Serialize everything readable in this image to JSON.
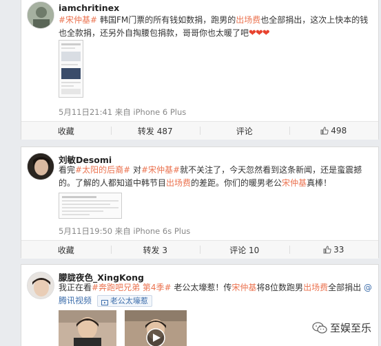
{
  "posts": [
    {
      "author": "iamchritinex",
      "text_parts": [
        {
          "t": "#宋仲基#",
          "c": "tag"
        },
        {
          "t": " 韩国FM门票的所有钱如数捐，跑男的",
          "c": ""
        },
        {
          "t": "出场费",
          "c": "tag"
        },
        {
          "t": "也全部捐出，这次上快本的钱也全款捐，还另外自掏腰包捐款，哥哥你也太暖了吧",
          "c": ""
        }
      ],
      "hearts": "❤❤❤",
      "meta": "5月11日21:41 来自 iPhone 6 Plus",
      "actions": {
        "collect": "收藏",
        "repost": "转发 487",
        "comment": "评论",
        "like": "498"
      }
    },
    {
      "author": "刘敏Desomi",
      "text_parts": [
        {
          "t": "看完",
          "c": ""
        },
        {
          "t": "#太阳的后裔#",
          "c": "tag"
        },
        {
          "t": " 对",
          "c": ""
        },
        {
          "t": "#宋仲基#",
          "c": "tag"
        },
        {
          "t": "就不关注了，今天忽然看到这条新闻，还是蛮震撼的。了解的人都知道中韩节目",
          "c": ""
        },
        {
          "t": "出场费",
          "c": "tag"
        },
        {
          "t": "的差距。你们的暖男老公",
          "c": ""
        },
        {
          "t": "宋仲基",
          "c": "tag"
        },
        {
          "t": "真棒！",
          "c": ""
        }
      ],
      "meta": "5月11日19:50 来自 iPhone 6s Plus",
      "actions": {
        "collect": "收藏",
        "repost": "转发 3",
        "comment": "评论 10",
        "like": "33"
      }
    },
    {
      "author": "朦胧夜色_XingKong",
      "text_parts": [
        {
          "t": "我正在看",
          "c": ""
        },
        {
          "t": "#奔跑吧兄弟 第4季#",
          "c": "tag"
        },
        {
          "t": " 老公太壕惹！传",
          "c": ""
        },
        {
          "t": "宋仲基",
          "c": "tag"
        },
        {
          "t": "将8位数跑男",
          "c": ""
        },
        {
          "t": "出场费",
          "c": "tag"
        },
        {
          "t": "全部捐出 ",
          "c": ""
        },
        {
          "t": "@腾讯视频",
          "c": "link"
        }
      ],
      "chip": "老公太壕惹"
    }
  ],
  "watermark": {
    "icon": "wechat-icon",
    "text": "至娱至乐"
  },
  "colors": {
    "tag": "#eb7350",
    "link": "#3c6dab",
    "heart": "#e8432f",
    "bg": "#e9ebee"
  }
}
